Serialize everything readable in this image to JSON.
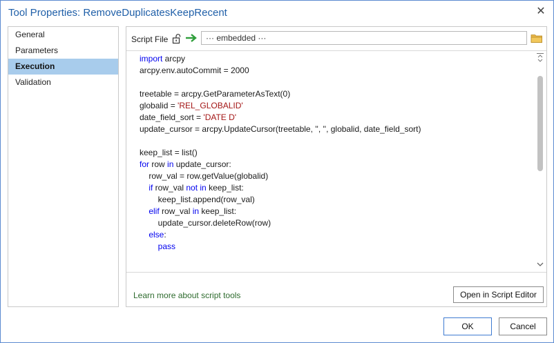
{
  "window": {
    "title": "Tool Properties: RemoveDuplicatesKeepRecent"
  },
  "tabs": [
    {
      "label": "General"
    },
    {
      "label": "Parameters"
    },
    {
      "label": "Execution",
      "active": true
    },
    {
      "label": "Validation"
    }
  ],
  "script": {
    "label": "Script File",
    "value": "··· embedded ···"
  },
  "code": {
    "lines": [
      [
        {
          "t": "import",
          "c": "kw"
        },
        {
          "t": " arcpy"
        }
      ],
      [
        {
          "t": "arcpy.env.autoCommit = 2000"
        }
      ],
      [],
      [
        {
          "t": "treetable = arcpy.GetParameterAsText(0)"
        }
      ],
      [
        {
          "t": "globalid = "
        },
        {
          "t": "'REL_GLOBALID'",
          "c": "str"
        }
      ],
      [
        {
          "t": "date_field_sort = "
        },
        {
          "t": "'DATE D'",
          "c": "str"
        }
      ],
      [
        {
          "t": "update_cursor = arcpy.UpdateCursor(treetable, '', '', globalid, date_field_sort)"
        }
      ],
      [],
      [
        {
          "t": "keep_list = list()"
        }
      ],
      [
        {
          "t": "for",
          "c": "kw"
        },
        {
          "t": " row "
        },
        {
          "t": "in",
          "c": "kw"
        },
        {
          "t": " update_cursor:"
        }
      ],
      [
        {
          "t": "    row_val = row.getValue(globalid)"
        }
      ],
      [
        {
          "t": "    "
        },
        {
          "t": "if",
          "c": "kw"
        },
        {
          "t": " row_val "
        },
        {
          "t": "not in",
          "c": "kw"
        },
        {
          "t": " keep_list:"
        }
      ],
      [
        {
          "t": "        keep_list.append(row_val)"
        }
      ],
      [
        {
          "t": "    "
        },
        {
          "t": "elif",
          "c": "kw"
        },
        {
          "t": " row_val "
        },
        {
          "t": "in",
          "c": "kw"
        },
        {
          "t": " keep_list:"
        }
      ],
      [
        {
          "t": "        update_cursor.deleteRow(row)"
        }
      ],
      [
        {
          "t": "    "
        },
        {
          "t": "else",
          "c": "kw"
        },
        {
          "t": ":"
        }
      ],
      [
        {
          "t": "        "
        },
        {
          "t": "pass",
          "c": "kw"
        }
      ]
    ]
  },
  "footer": {
    "learn_link": "Learn more about script tools",
    "open_editor": "Open in Script Editor"
  },
  "buttons": {
    "ok": "OK",
    "cancel": "Cancel"
  },
  "colors": {
    "title": "#1f5fa8",
    "active_tab": "#a8ccec",
    "keyword": "#0000ee",
    "string": "#a31515",
    "link": "#2e6b2e"
  },
  "icons": [
    "close-icon",
    "unlock-icon",
    "arrow-right-icon",
    "folder-icon",
    "scroll-up-icon",
    "scroll-down-icon"
  ]
}
